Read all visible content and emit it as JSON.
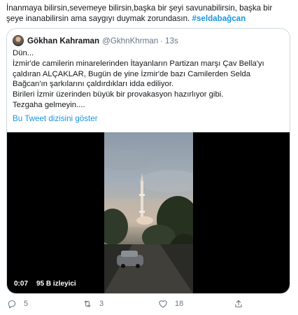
{
  "tweet": {
    "text_lines": [
      "İnanmaya bilirsin,sevemeye bilirsin,başka bir şeyi savunabilirsin, başka bir",
      "şeye inanabilirsin ama saygıyı duymak zorundasın."
    ],
    "hashtag": "#seldabağcan"
  },
  "quoted_tweet": {
    "author_name": "Gökhan Kahraman",
    "author_handle": "@GkhnKhrman",
    "separator": "·",
    "time": "13s",
    "body_lines": [
      "Dün...",
      "İzmir'de camilerin minarelerinden İtayanların Partizan marşı Çav Bella'yı",
      "çaldıran ALÇAKLAR, Bugün de yine İzmir'de bazı Camilerden Selda",
      "Bağcan'ın şarkılarını çaldırdıkları idda ediliyor.",
      "Birileri İzmir üzerinden büyük bir provakasyon hazırlıyor gibi.",
      "Tezgaha gelmeyin...."
    ],
    "thread_link": "Bu Tweet dizisini göster",
    "video": {
      "duration": "0:07",
      "views": "95 B izleyici"
    }
  },
  "actions": {
    "reply_icon": "reply-icon",
    "reply_count": "5",
    "retweet_icon": "retweet-icon",
    "retweet_count": "3",
    "like_icon": "heart-icon",
    "like_count": "18",
    "share_icon": "share-icon"
  },
  "colors": {
    "link": "#1b95e0",
    "muted": "#657786",
    "border": "#cfd9de"
  }
}
